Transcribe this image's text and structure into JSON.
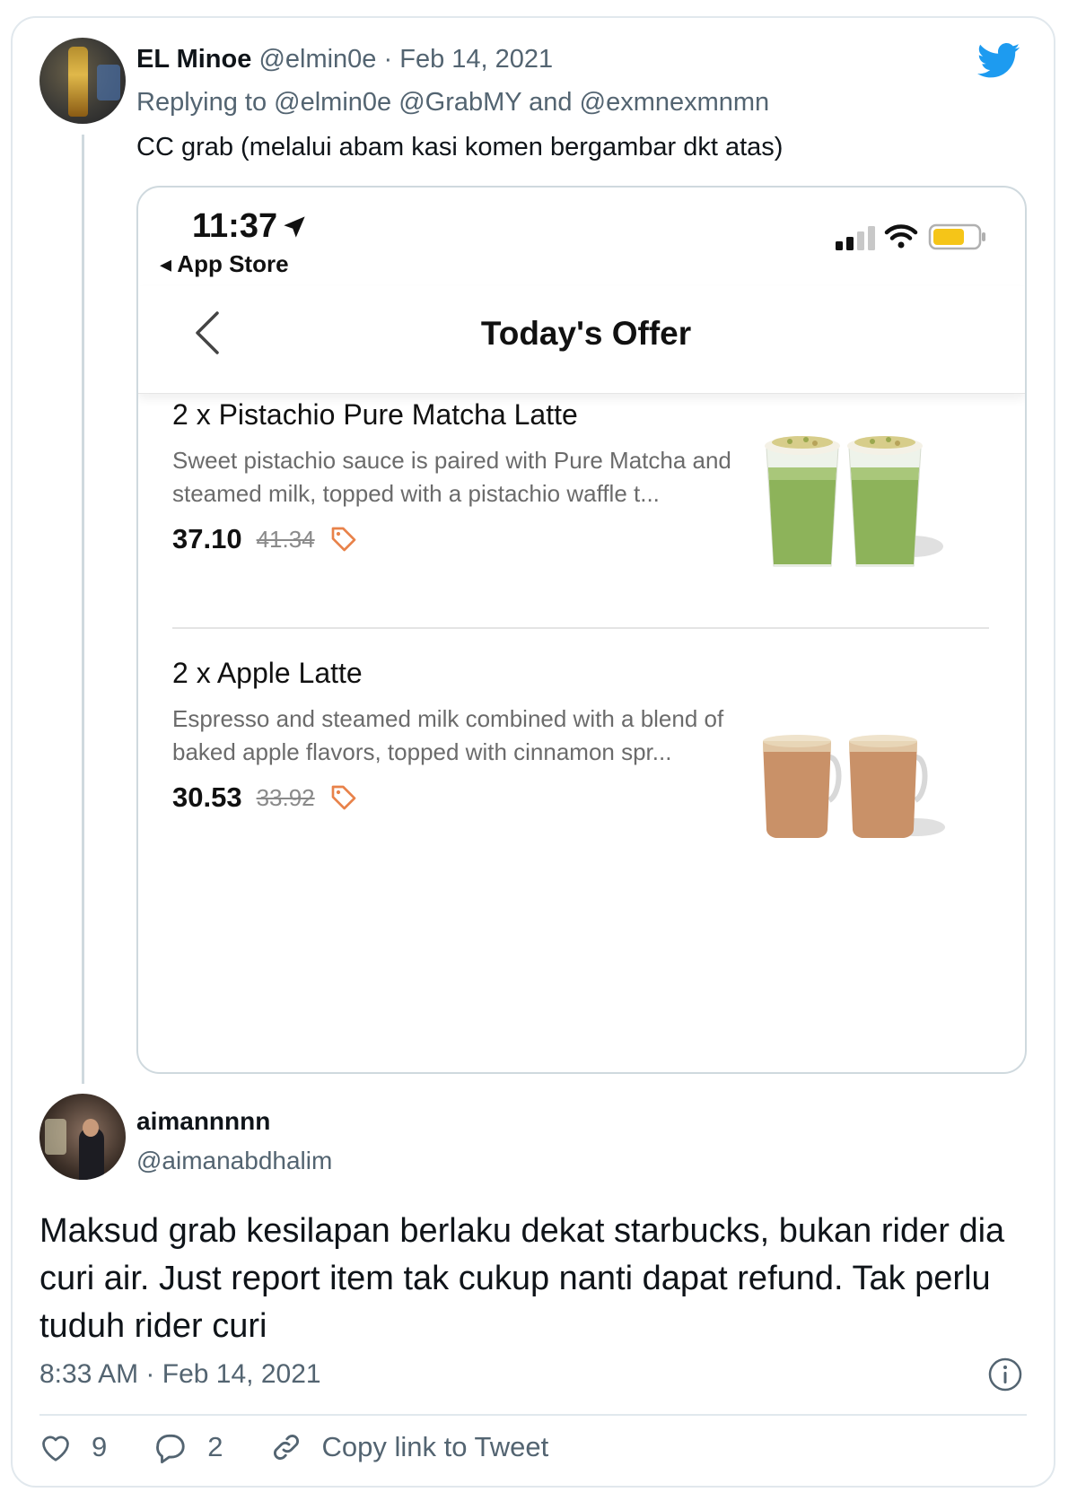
{
  "tweet1": {
    "name": "EL Minoe",
    "handle": "@elmin0e",
    "separator": "·",
    "date": "Feb 14, 2021",
    "replying_prefix": "Replying to",
    "replying_to_1": "@elmin0e",
    "replying_to_2": "@GrabMY",
    "replying_and": "and",
    "replying_to_3": "@exmnexmnmn",
    "text": "CC grab (melalui abam kasi komen bergambar dkt atas)"
  },
  "screenshot": {
    "time": "11:37",
    "back_app": "◂ App Store",
    "nav_title": "Today's Offer",
    "offers": [
      {
        "title": "2 x Pistachio Pure Matcha Latte",
        "description": "Sweet pistachio sauce is paired with Pure Matcha and steamed milk, topped with a pistachio waffle t...",
        "price": "37.10",
        "old_price": "41.34"
      },
      {
        "title": "2 x Apple Latte",
        "description": "Espresso and steamed milk combined with a blend of baked apple flavors, topped with cinnamon spr...",
        "price": "30.53",
        "old_price": "33.92"
      }
    ]
  },
  "tweet2": {
    "name": "aimannnnn",
    "handle": "@aimanabdhalim",
    "text": "Maksud grab kesilapan berlaku dekat starbucks, bukan rider dia curi air. Just report item tak cukup nanti dapat refund. Tak perlu tuduh rider curi",
    "time": "8:33 AM",
    "separator": "·",
    "date": "Feb 14, 2021",
    "likes": "9",
    "replies": "2",
    "copy_link_label": "Copy link to Tweet"
  },
  "icons": {
    "brand": "twitter-bird-icon",
    "like": "heart-icon",
    "reply": "comment-icon",
    "copy": "link-icon",
    "info": "info-icon",
    "tag": "tag-icon"
  },
  "colors": {
    "twitter_blue": "#1d9bf0",
    "muted_text": "#536471",
    "tag_orange": "#e8824a",
    "battery_yellow": "#f5c518"
  }
}
